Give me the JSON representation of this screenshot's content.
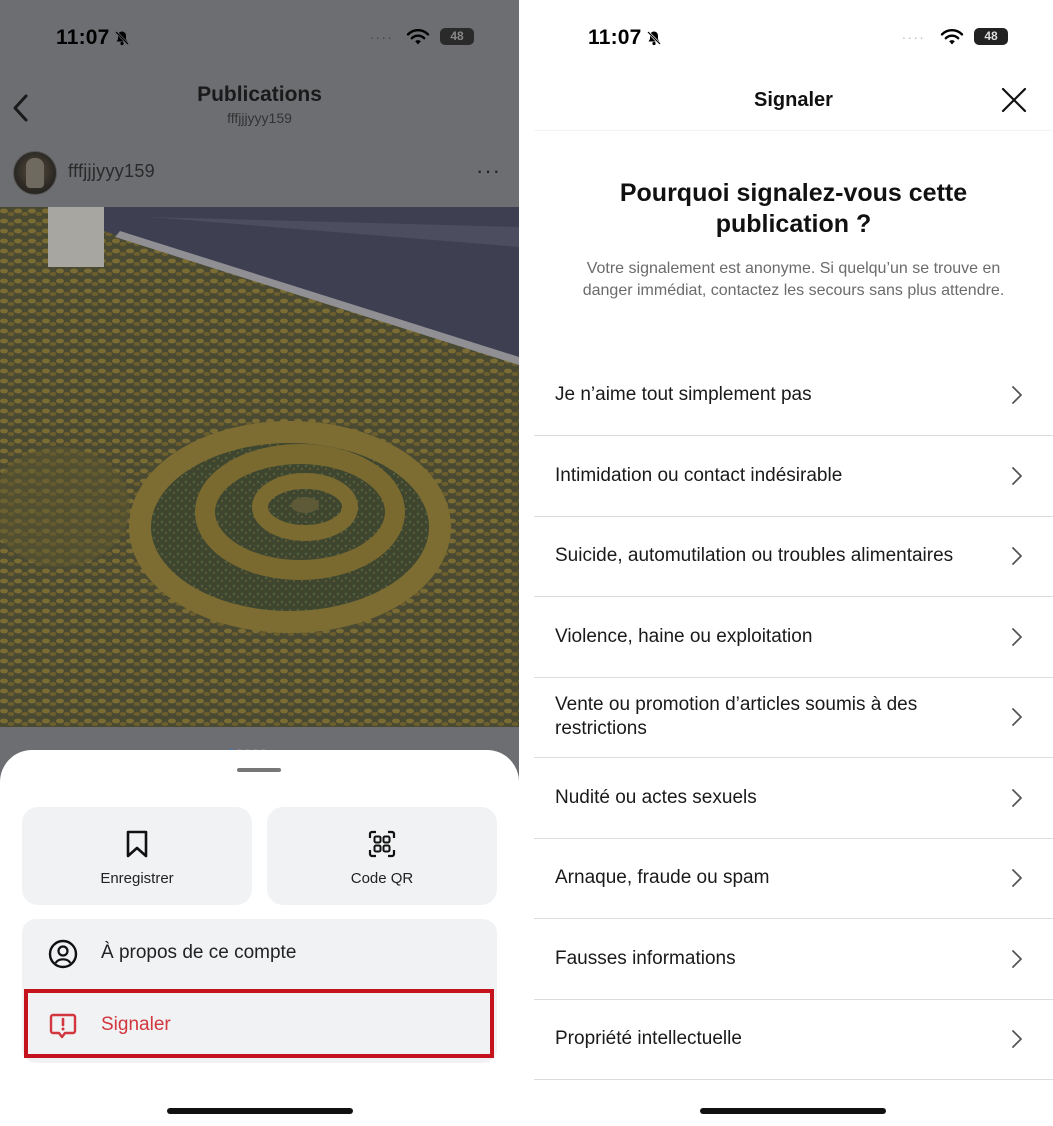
{
  "left_screen": {
    "status": {
      "time": "11:07",
      "battery": "48"
    },
    "header": {
      "title": "Publications",
      "subtitle": "fffjjjyyy159"
    },
    "post": {
      "username": "fffjjjyyy159",
      "more_icon": "more-horizontal-icon",
      "carousel_pages": 5,
      "carousel_active": 1
    },
    "sheet": {
      "save_label": "Enregistrer",
      "qr_label": "Code QR",
      "about_label": "À propos de ce compte",
      "report_label": "Signaler"
    },
    "colors": {
      "report_red": "#d2363e",
      "highlight_red": "#c5131d",
      "overlay": "#6d6e72"
    }
  },
  "right_screen": {
    "status": {
      "time": "11:07",
      "battery": "48"
    },
    "title": "Signaler",
    "question": "Pourquoi signalez-vous cette publication ?",
    "subtitle": "Votre signalement est anonyme. Si quelqu’un se trouve en danger immédiat, contactez les secours sans plus attendre.",
    "reasons": [
      "Je n’aime tout simplement pas",
      "Intimidation ou contact indésirable",
      "Suicide, automutilation ou troubles alimentaires",
      "Violence, haine ou exploitation",
      "Vente ou promotion d’articles soumis à des restrictions",
      "Nudité ou actes sexuels",
      "Arnaque, fraude ou spam",
      "Fausses informations",
      "Propriété intellectuelle"
    ]
  }
}
